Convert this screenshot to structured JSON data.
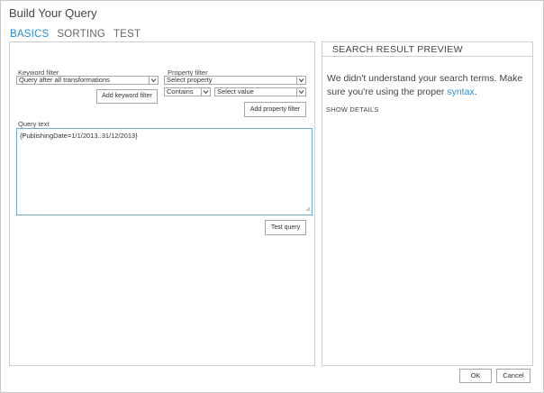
{
  "dialog": {
    "title": "Build Your Query"
  },
  "tabs": [
    {
      "label": "BASICS",
      "active": true
    },
    {
      "label": "SORTING",
      "active": false
    },
    {
      "label": "TEST",
      "active": false
    }
  ],
  "keyword_filter": {
    "label": "Keyword filter",
    "selected": "Query after all transformations",
    "add_button": "Add keyword filter"
  },
  "property_filter": {
    "label": "Property filter",
    "property_selected": "Select property",
    "operator_selected": "Contains",
    "value_selected": "Select value",
    "add_button": "Add property filter"
  },
  "query_text": {
    "label": "Query text",
    "value": "{PublishingDate=1/1/2013..31/12/2013}"
  },
  "test_query_button": "Test query",
  "preview": {
    "header": "SEARCH RESULT PREVIEW",
    "message": "We didn't understand your search terms. Make sure you're using the proper",
    "link": "syntax",
    "message_end": ".",
    "show_details": "SHOW DETAILS"
  },
  "footer": {
    "ok": "OK",
    "cancel": "Cancel"
  },
  "colors": {
    "accent": "#2a8dd4",
    "border": "#cfcfcf"
  }
}
